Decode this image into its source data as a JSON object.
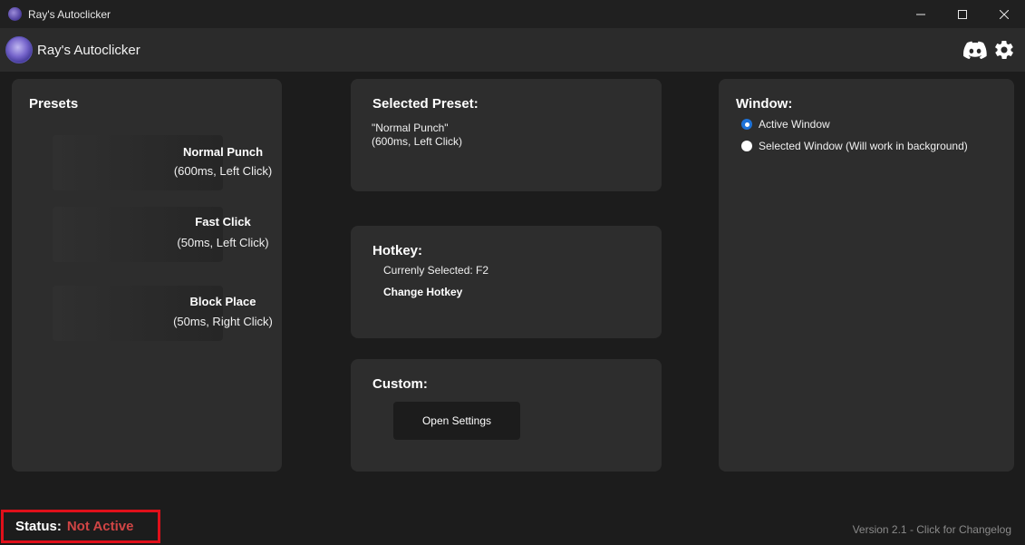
{
  "window": {
    "title": "Ray's Autoclicker"
  },
  "header": {
    "app_name": "Ray's Autoclicker",
    "icons": [
      "discord-icon",
      "gear-icon"
    ]
  },
  "presets": {
    "title": "Presets",
    "items": [
      {
        "name": "Normal Punch",
        "detail": "(600ms, Left Click)"
      },
      {
        "name": "Fast Click",
        "detail": "(50ms, Left Click)"
      },
      {
        "name": "Block Place",
        "detail": "(50ms, Right Click)"
      }
    ]
  },
  "selected_preset": {
    "title": "Selected Preset:",
    "name_line": "\"Normal Punch\"",
    "detail_line": "(600ms, Left Click)"
  },
  "hotkey": {
    "title": "Hotkey:",
    "current": "Currenly Selected: F2",
    "change_label": "Change Hotkey"
  },
  "custom": {
    "title": "Custom:",
    "open_settings_label": "Open Settings"
  },
  "window_target": {
    "title": "Window:",
    "options": [
      {
        "label": "Active Window",
        "checked": true
      },
      {
        "label": "Selected Window (Will work in background)",
        "checked": false
      }
    ]
  },
  "footer": {
    "status_label": "Status:",
    "status_value": "Not Active",
    "version_text": "Version 2.1 - Click for Changelog"
  },
  "colors": {
    "accent_radio": "#1d72d8",
    "status_inactive": "#d04545",
    "highlight_border": "#e0101a"
  }
}
